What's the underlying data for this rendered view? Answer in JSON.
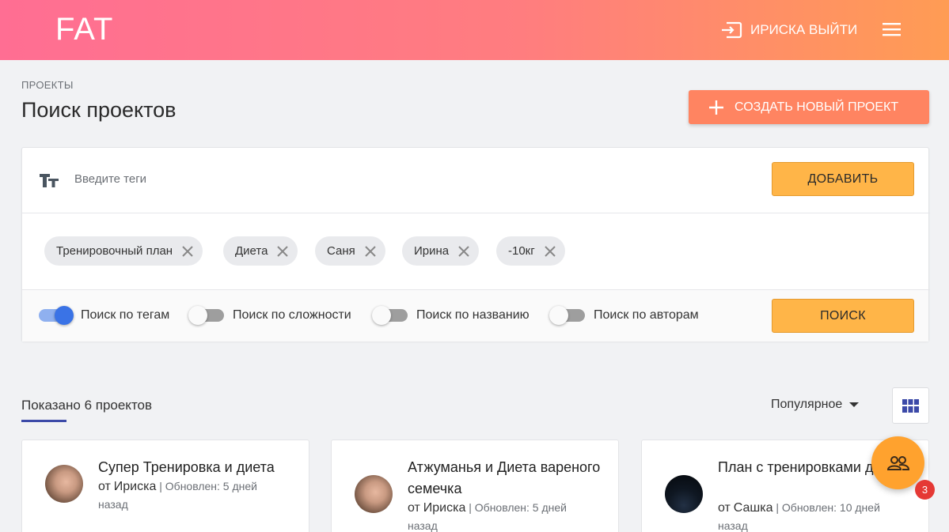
{
  "header": {
    "logo": "FAT",
    "logout_label": "ИРИСКА ВЫЙТИ"
  },
  "page": {
    "breadcrumb": "ПРОЕКТЫ",
    "title": "Поиск проектов",
    "create_label": "СОЗДАТЬ НОВЫЙ ПРОЕКТ"
  },
  "search": {
    "tag_placeholder": "Введите теги",
    "add_label": "ДОБАВИТЬ",
    "search_label": "ПОИСК",
    "chips": [
      "Тренировочный план",
      "Диета",
      "Саня",
      "Ирина",
      "-10кг"
    ],
    "toggles": [
      {
        "label": "Поиск по тегам",
        "on": true
      },
      {
        "label": "Поиск по сложности",
        "on": false
      },
      {
        "label": "Поиск по названию",
        "on": false
      },
      {
        "label": "Поиск по авторам",
        "on": false
      }
    ]
  },
  "results": {
    "count_label": "Показано 6 проектов",
    "sort_label": "Популярное"
  },
  "cards": [
    {
      "title": "Супер Тренировка и диета",
      "by": "от",
      "author": "Ириска",
      "updated": "Обновлен: 5 дней назад",
      "avatar": "photo-girl"
    },
    {
      "title": "Атжуманья и Диета вареного семечка",
      "by": "от",
      "author": "Ириска",
      "updated": "Обновлен: 5 дней назад",
      "avatar": "photo-girl"
    },
    {
      "title": "План с тренировками диетой",
      "by": "от",
      "author": "Сашка",
      "updated": "Обновлен: 10 дней назад",
      "avatar": "photo-night"
    }
  ],
  "fab": {
    "icon": "people-icon",
    "badge": "3"
  },
  "colors": {
    "header_start": "#ff6e93",
    "header_end": "#ff9c54",
    "accent_orange": "#ff8461",
    "yellow": "#ffb548",
    "toggle_on": "#3a73e6"
  }
}
